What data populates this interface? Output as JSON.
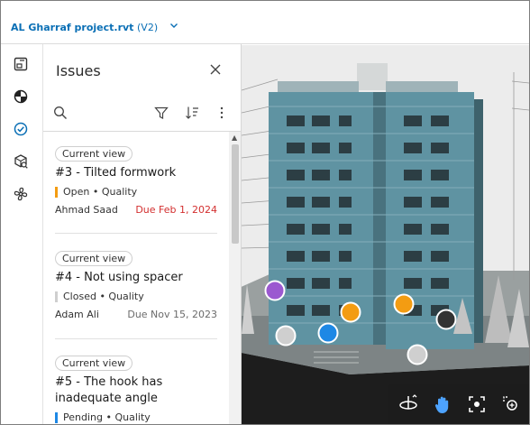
{
  "header": {
    "file_name": "AL Gharraf project.rvt",
    "version": "(V2)"
  },
  "rail": {
    "icons": [
      "sheets-icon",
      "models-icon",
      "issues-icon",
      "search-model-icon",
      "fan-icon"
    ]
  },
  "panel": {
    "title": "Issues"
  },
  "issues": [
    {
      "chip": "Current view",
      "title": "#3 - Tilted formwork",
      "status": "Open • Quality",
      "status_color": "#f39c12",
      "assignee": "Ahmad Saad",
      "due": "Due Feb 1, 2024",
      "overdue": true
    },
    {
      "chip": "Current view",
      "title": "#4 - Not using spacer",
      "status": "Closed • Quality",
      "status_color": "#cfcfcf",
      "assignee": "Adam Ali",
      "due": "Due Nov 15, 2023",
      "overdue": false
    },
    {
      "chip": "Current view",
      "title": "#5 - The hook has inadequate angle",
      "status": "Pending • Quality",
      "status_color": "#1e88e5"
    }
  ],
  "colors": {
    "accent": "#0a6fb5",
    "open": "#f39c12",
    "pending": "#1e88e5",
    "closed": "#cfcfcf",
    "overdue": "#d32f2f",
    "pin_purple": "#9b59d0",
    "pin_dark": "#333333"
  },
  "viewport": {
    "pins": [
      {
        "id": "pin-purple",
        "color": "#9b59d0"
      },
      {
        "id": "pin-orange-1",
        "color": "#f39c12"
      },
      {
        "id": "pin-orange-2",
        "color": "#f39c12"
      },
      {
        "id": "pin-blue",
        "color": "#1e88e5"
      },
      {
        "id": "pin-gray-1",
        "color": "#cfcfcf"
      },
      {
        "id": "pin-gray-2",
        "color": "#cfcfcf"
      },
      {
        "id": "pin-dark",
        "color": "#333333"
      }
    ],
    "toolbar": [
      "orbit-icon",
      "pan-hand-icon",
      "fit-view-icon",
      "zoom-icon"
    ]
  }
}
